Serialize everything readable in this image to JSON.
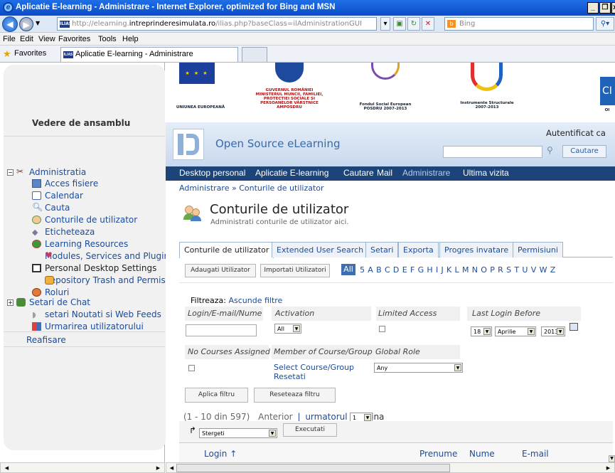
{
  "window": {
    "title": "Aplicatie E-learning - Administrare - Internet Explorer, optimized for Bing and MSN",
    "controls": [
      "_",
      "❐",
      "x"
    ]
  },
  "address": {
    "url_prefix": "http://elearning.",
    "url_domain": "intreprinderesimulata.ro",
    "url_suffix": "/ilias.php?baseClass=ilAdministrationGUI",
    "favicon": "ILIAS",
    "search_placeholder": "Bing"
  },
  "menu": [
    "File",
    "Edit",
    "View",
    "Favorites",
    "Tools",
    "Help"
  ],
  "favorites_bar": {
    "label": "Favorites",
    "tab": "Aplicatie E-learning - Administrare"
  },
  "sidebar": {
    "title": "Vedere de ansamblu",
    "items": [
      {
        "label": "Administratia",
        "icon": "tools-icon"
      },
      {
        "label": "Acces fisiere",
        "icon": "file-access-icon"
      },
      {
        "label": "Calendar",
        "icon": "calendar-icon"
      },
      {
        "label": "Cauta",
        "icon": "search-icon"
      },
      {
        "label": "Conturile de utilizator",
        "icon": "users-icon"
      },
      {
        "label": "Eticheteaza",
        "icon": "tag-icon"
      },
      {
        "label": "Learning Resources",
        "icon": "learning-resources-icon"
      },
      {
        "label": "Modules, Services and Plugins",
        "icon": "modules-icon"
      },
      {
        "label": "Personal Desktop Settings",
        "icon": "desktop-icon"
      },
      {
        "label": "Repository Trash and Permissions",
        "icon": "trash-icon"
      },
      {
        "label": "Roluri",
        "icon": "roles-icon"
      },
      {
        "label": "Setari de Chat",
        "icon": "chat-icon"
      },
      {
        "label": "setari Noutati si Web Feeds",
        "icon": "feed-icon"
      },
      {
        "label": "Urmarirea utilizatorului",
        "icon": "tracking-icon"
      }
    ],
    "reafisare": "Reafisare"
  },
  "banner": {
    "eu": "UNIUNEA EUROPEANĂ",
    "guvern": "GUVERNUL ROMÂNIEI MINISTERUL MUNCII, FAMILIEI, PROTECȚIEI SOCIALE ȘI PERSOANELOR VÂRSTNICE AMPOSDRU",
    "fse": "Fondul Social European POSDRU 2007-2013",
    "instrumente": "Instrumente Structurale 2007-2013",
    "right_fragment": "CI",
    "right_small": "OI"
  },
  "header": {
    "logo_text": "Open Source eLearning",
    "auth": "Autentificat ca",
    "search_button": "Cautare"
  },
  "nav": [
    "Desktop personal",
    "Aplicatie E-learning",
    "Cautare",
    "Mail",
    "Administrare",
    "Ultima vizita"
  ],
  "breadcrumb": "Administrare » Conturile de utilizator",
  "page": {
    "title": "Conturile de utilizator",
    "subtitle": "Administrati conturile de utilizator aici."
  },
  "tabs": [
    "Conturile de utilizator",
    "Extended User Search",
    "Setari",
    "Exporta",
    "Progres invatare",
    "Permisiuni"
  ],
  "toolbar": {
    "add_user": "Adaugati Utilizator",
    "import_users": "Importati Utilizatori",
    "all": "All",
    "letters": "5 A B C D E F G H I J K L M N O P R S T U V W Z"
  },
  "filter": {
    "title_label": "Filtreaza:",
    "title_link": "Ascunde filtre",
    "login_label": "Login/E-mail/Nume",
    "activation_label": "Activation",
    "activation_value": "All",
    "limited_label": "Limited Access",
    "last_login_label": "Last Login Before",
    "day": "18",
    "month": "Aprilie",
    "year": "2013",
    "no_courses_label": "No Courses Assigned",
    "member_label": "Member of Course/Group",
    "select_course": "Select Course/Group",
    "resetati": "Resetati",
    "global_role_label": "Global Role",
    "global_role_value": "Any",
    "apply": "Aplica filtru",
    "reset": "Reseteaza filtru"
  },
  "pagination": {
    "range": "(1 - 10 din 597)",
    "prev": "Anterior",
    "sep": "|",
    "next": "urmatorul",
    "page_label": "Pagina",
    "page_value": "1"
  },
  "actions": {
    "select": "Stergeti",
    "execute": "Executati"
  },
  "table_headers": [
    "Login ↑",
    "Prenume",
    "Nume",
    "E-mail"
  ],
  "colors": {
    "nav_bg": "#1d4478",
    "link": "#1a4b9b",
    "title_blue": "#0a4bc9"
  }
}
